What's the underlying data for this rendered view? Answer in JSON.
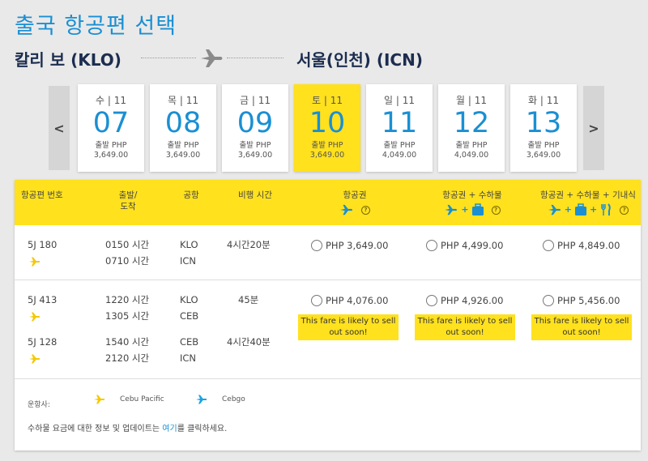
{
  "page": {
    "title": "출국 항공편 선택"
  },
  "route": {
    "origin": "칼리 보 (KLO)",
    "destination": "서울(인천) (ICN)"
  },
  "date_strip": {
    "prev_label": "<",
    "next_label": ">",
    "dates": [
      {
        "dow": "수 | 11",
        "day": "07",
        "label": "출발 PHP",
        "price": "3,649.00",
        "selected": false
      },
      {
        "dow": "목 | 11",
        "day": "08",
        "label": "출발 PHP",
        "price": "3,649.00",
        "selected": false
      },
      {
        "dow": "금 | 11",
        "day": "09",
        "label": "출발 PHP",
        "price": "3,649.00",
        "selected": false
      },
      {
        "dow": "토 | 11",
        "day": "10",
        "label": "출발 PHP",
        "price": "3,649.00",
        "selected": true
      },
      {
        "dow": "일 | 11",
        "day": "11",
        "label": "출발 PHP",
        "price": "4,049.00",
        "selected": false
      },
      {
        "dow": "월 | 11",
        "day": "12",
        "label": "출발 PHP",
        "price": "4,049.00",
        "selected": false
      },
      {
        "dow": "화 | 11",
        "day": "13",
        "label": "출발 PHP",
        "price": "3,649.00",
        "selected": false
      }
    ]
  },
  "table": {
    "headers": {
      "flight_no": "항공편 번호",
      "depart_arrive_1": "출발/",
      "depart_arrive_2": "도착",
      "airport": "공항",
      "duration": "비행 시간",
      "fare1": "항공권",
      "fare2": "항공권 + 수하물",
      "fare3": "항공권 + 수하물 + 기내식"
    },
    "info_icon": "?",
    "plus": "+",
    "rows": [
      {
        "segments": [
          {
            "flight": "5J 180",
            "depart": "0150 시간",
            "arrive": "0710 시간",
            "from": "KLO",
            "to": "ICN",
            "duration": "4시간20분"
          }
        ],
        "fares": [
          "PHP 3,649.00",
          "PHP 4,499.00",
          "PHP 4,849.00"
        ]
      },
      {
        "segments": [
          {
            "flight": "5J 413",
            "depart": "1220 시간",
            "arrive": "1305 시간",
            "from": "KLO",
            "to": "CEB",
            "duration": "45분"
          },
          {
            "flight": "5J 128",
            "depart": "1540 시간",
            "arrive": "2120 시간",
            "from": "CEB",
            "to": "ICN",
            "duration": "4시간40분"
          }
        ],
        "fares": [
          "PHP 4,076.00",
          "PHP 4,926.00",
          "PHP 5,456.00"
        ],
        "notice": "This fare is likely to sell out soon!"
      }
    ]
  },
  "footer": {
    "operator_label": "운항사:",
    "operators": [
      "Cebu Pacific",
      "Cebgo"
    ],
    "note_prefix": "수하물 요금에 대한 정보 및 업데이트는 ",
    "note_link": "여기",
    "note_suffix": "를 클릭하세요."
  },
  "colors": {
    "accent_yellow": "#ffe11e",
    "accent_blue": "#1a8fd3",
    "navy": "#1c2d4f",
    "background": "#e9e9e9"
  }
}
